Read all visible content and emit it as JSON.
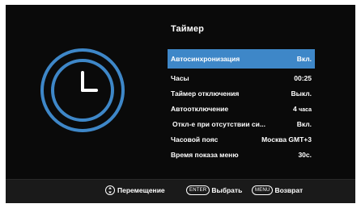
{
  "colors": {
    "accent": "#3e87c8",
    "background": "#0a0a0a",
    "footer": "#1a1a1a",
    "text": "#ffffff"
  },
  "icons": {
    "hero": "clock-icon",
    "navigate": "dpad-icon"
  },
  "menu": {
    "title": "Таймер",
    "items": [
      {
        "label": "Автосинхронизация",
        "value": "Вкл."
      },
      {
        "label": "Часы",
        "value": "00:25"
      },
      {
        "label": "Таймер отключения",
        "value": "Выкл."
      },
      {
        "label": "Автоотключение",
        "value_num": "4",
        "value_unit": "часа"
      },
      {
        "label": "Откл-е при отсутствии си...",
        "value": "Вкл."
      },
      {
        "label": "Часовой пояс",
        "value": "Москва GMT+3"
      },
      {
        "label": "Время показа меню",
        "value": "30с."
      }
    ]
  },
  "footer": {
    "navigate_label": "Перемещение",
    "enter_key": "ENTER",
    "enter_label": "Выбрать",
    "menu_key": "MENU",
    "menu_label": "Возврат"
  }
}
